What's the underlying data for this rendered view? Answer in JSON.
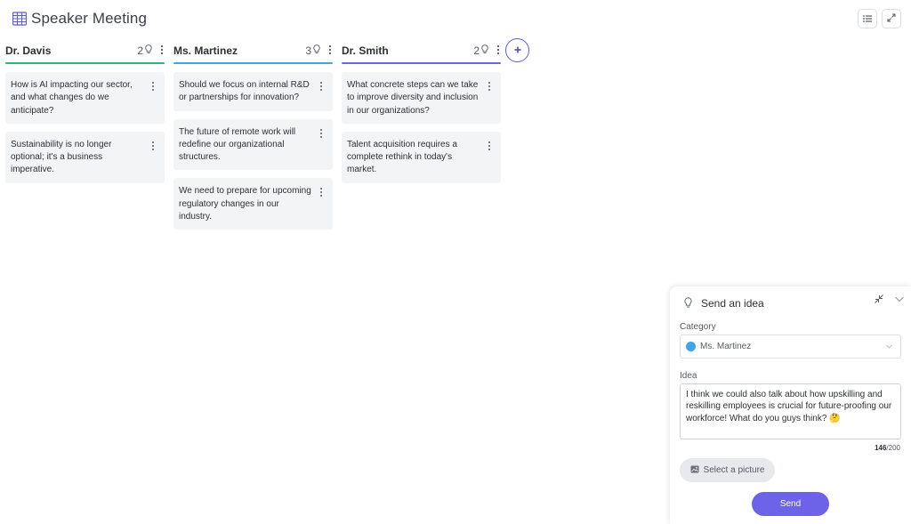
{
  "header": {
    "title": "Speaker Meeting",
    "icons": [
      "board-icon",
      "list-icon",
      "expand-icon"
    ]
  },
  "columns": [
    {
      "name": "Dr. Davis",
      "count": "2",
      "color": "#2bb673",
      "cards": [
        "How is AI impacting our sector, and what changes do we anticipate?",
        "Sustainability is no longer optional; it's a business imperative."
      ]
    },
    {
      "name": "Ms. Martinez",
      "count": "3",
      "color": "#3ea6e6",
      "cards": [
        "Should we focus on internal R&D or partnerships for innovation?",
        "The future of remote work will redefine our organizational structures.",
        "We need to prepare for upcoming regulatory changes in our industry."
      ]
    },
    {
      "name": "Dr. Smith",
      "count": "2",
      "color": "#6c63e8",
      "cards": [
        "What concrete steps can we take to improve diversity and inclusion in our organizations?",
        "Talent acquisition requires a complete rethink in today's market."
      ]
    }
  ],
  "panel": {
    "title": "Send an idea",
    "category_label": "Category",
    "category_value": "Ms. Martinez",
    "category_color": "#3ea6e6",
    "idea_label": "Idea",
    "idea_text": "I think we could also talk about how upskilling and reskilling employees is crucial for future-proofing our workforce! What do you guys think? 🤔",
    "counter_current": "146",
    "counter_max": "/200",
    "picture_label": "Select a picture",
    "send_label": "Send"
  },
  "accent": "#6c63e8"
}
